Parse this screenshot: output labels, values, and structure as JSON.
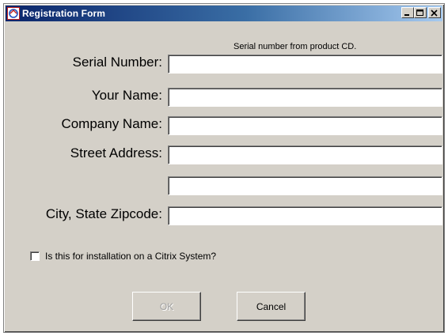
{
  "window": {
    "title": "Registration Form",
    "buttons": {
      "minimize": "_",
      "maximize": "□",
      "close": "X"
    }
  },
  "form": {
    "serial_hint": "Serial number from product CD.",
    "fields": [
      {
        "label": "Serial Number:",
        "value": ""
      },
      {
        "label": "Your Name:",
        "value": ""
      },
      {
        "label": "Company Name:",
        "value": ""
      },
      {
        "label": "Street Address:",
        "value": ""
      },
      {
        "label": "",
        "value": ""
      },
      {
        "label": "City, State Zipcode:",
        "value": ""
      }
    ],
    "citrix_checkbox": {
      "label": "Is this for installation on a Citrix System?",
      "checked": false
    }
  },
  "actions": {
    "ok_label": "OK",
    "ok_enabled": false,
    "cancel_label": "Cancel"
  },
  "colors": {
    "titlebar_start": "#0a246a",
    "titlebar_end": "#a6caf0",
    "dialog_bg": "#d4d0c8"
  }
}
